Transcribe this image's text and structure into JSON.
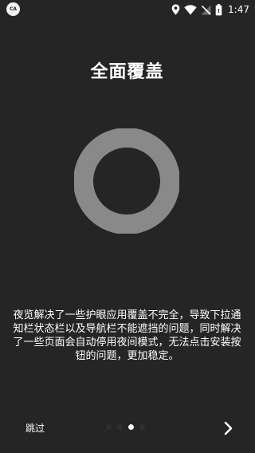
{
  "status_bar": {
    "app_badge": "CA",
    "time": "1:47",
    "icons": [
      "location-icon",
      "wifi-icon",
      "signal-off-icon",
      "battery-icon"
    ]
  },
  "onboarding": {
    "title": "全面覆盖",
    "description": "夜览解决了一些护眼应用覆盖不完全，导致下拉通知栏状态栏以及导航栏不能遮挡的问题，同时解决了一些页面会自动停用夜间模式，无法点击安装按钮的问题，更加稳定。",
    "ring_color": "#898989",
    "background_color": "#252525"
  },
  "footer": {
    "skip_label": "跳过",
    "pager": {
      "count": 4,
      "active_index": 2
    },
    "next_icon": "chevron-right-icon"
  }
}
